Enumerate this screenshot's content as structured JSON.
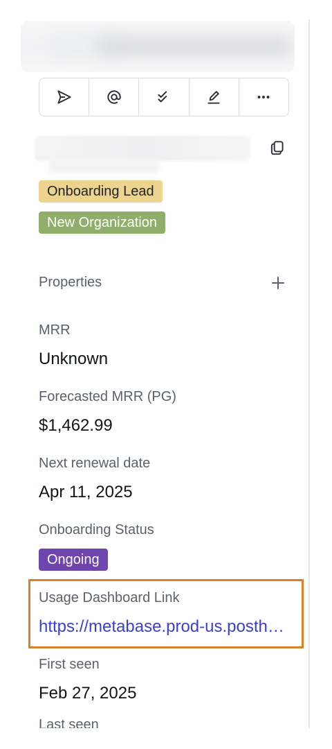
{
  "toolbar": {
    "buttons": [
      {
        "icon": "send-icon"
      },
      {
        "icon": "at-sign-icon"
      },
      {
        "icon": "double-check-icon"
      },
      {
        "icon": "edit-icon"
      },
      {
        "icon": "more-icon"
      }
    ]
  },
  "header": {
    "copy_icon": "copy-icon"
  },
  "tags": [
    {
      "label": "Onboarding Lead",
      "bg": "#ecd38f",
      "color": "#1f2328"
    },
    {
      "label": "New Organization",
      "bg": "#8fae69",
      "color": "#ffffff"
    }
  ],
  "properties": {
    "title": "Properties",
    "add_icon": "plus-icon",
    "mrr_label": "MRR",
    "mrr_value": "Unknown",
    "forecast_label": "Forecasted MRR (PG)",
    "forecast_value": "$1,462.99",
    "renewal_label": "Next renewal date",
    "renewal_value": "Apr 11, 2025",
    "onboarding_label": "Onboarding Status",
    "onboarding_value": "Ongoing",
    "onboarding_color": "#6e44ad",
    "usage_label": "Usage Dashboard Link",
    "usage_value": "https://metabase.prod-us.posthog.com",
    "first_seen_label": "First seen",
    "first_seen_value": "Feb 27, 2025",
    "last_label_partial": "Last seen"
  },
  "colors": {
    "highlight": "#d9802e",
    "link": "#3b3fd3"
  }
}
